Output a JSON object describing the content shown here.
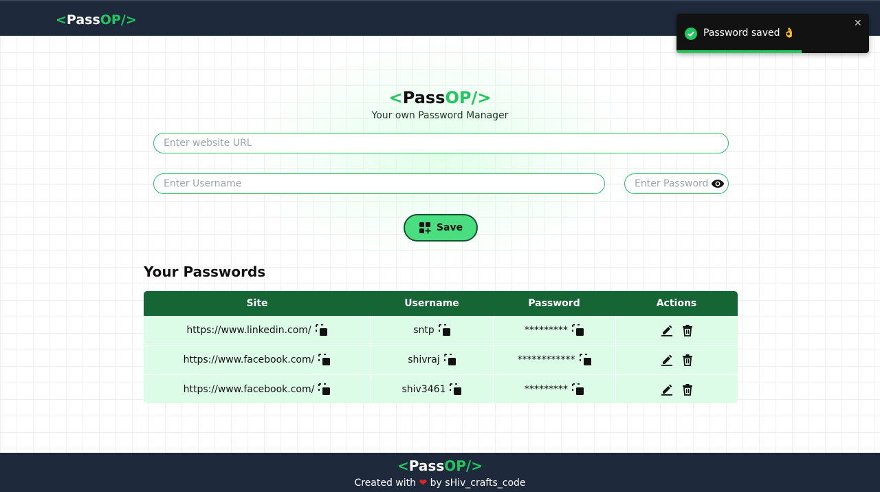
{
  "brand": {
    "open": "<",
    "name": "Pass",
    "accent": "OP/",
    "close": ">"
  },
  "hero": {
    "subtitle": "Your own Password Manager"
  },
  "form": {
    "url_placeholder": "Enter website URL",
    "username_placeholder": "Enter Username",
    "password_placeholder": "Enter Password",
    "save_label": "Save"
  },
  "passwords": {
    "title": "Your Passwords",
    "headers": {
      "site": "Site",
      "username": "Username",
      "password": "Password",
      "actions": "Actions"
    },
    "rows": [
      {
        "site": "https://www.linkedin.com/",
        "username": "sntp",
        "password": "*********"
      },
      {
        "site": "https://www.facebook.com/",
        "username": "shivraj",
        "password": "************"
      },
      {
        "site": "https://www.facebook.com/",
        "username": "shiv3461",
        "password": "*********"
      }
    ]
  },
  "toast": {
    "message": "Password saved",
    "emoji": "👌",
    "close": "✕",
    "progress": 0.65
  },
  "footer": {
    "created_with": "Created with",
    "heart": "❤",
    "by": "by sHiv_crafts_code"
  },
  "colors": {
    "accent": "#22c55e",
    "nav_bg": "#1e293b",
    "table_header": "#166534",
    "table_row": "#dcfce7",
    "button": "#4ade80"
  },
  "icons": {
    "copy": "copy-icon",
    "edit": "edit-icon",
    "delete": "trash-icon",
    "eye": "eye-icon",
    "save": "add-grid-icon",
    "success": "check-circle-icon"
  }
}
